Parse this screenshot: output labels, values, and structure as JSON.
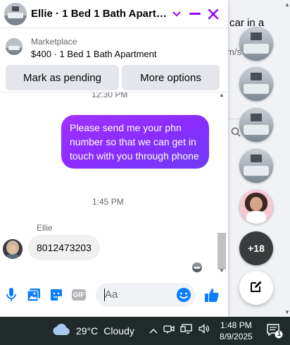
{
  "background_page": {
    "text_line1": "car in a",
    "text_line2": "m/s"
  },
  "chat": {
    "title": "Ellie · 1 Bed 1 Bath Apartm…",
    "listing": {
      "label": "Marketplace",
      "title": "$400 · 1 Bed 1 Bath Apartment"
    },
    "buttons": {
      "mark_pending": "Mark as pending",
      "more_options": "More options"
    },
    "thread": {
      "top_timestamp": "12:30 PM",
      "outgoing_message": "Please send me your phn number so that we can get in touch with you through phone",
      "mid_timestamp": "1:45 PM",
      "sender_name": "Ellie",
      "incoming_message": "8012473203"
    },
    "composer": {
      "placeholder": "Aa",
      "gif_label": "GIF"
    },
    "accent_color": "#9400ff",
    "messenger_blue": "#0a7cff"
  },
  "chat_heads": {
    "more_count": "+18"
  },
  "taskbar": {
    "temperature": "29°C",
    "condition": "Cloudy",
    "time": "1:48 PM",
    "date": "8/9/2025",
    "notification_count": "1"
  }
}
